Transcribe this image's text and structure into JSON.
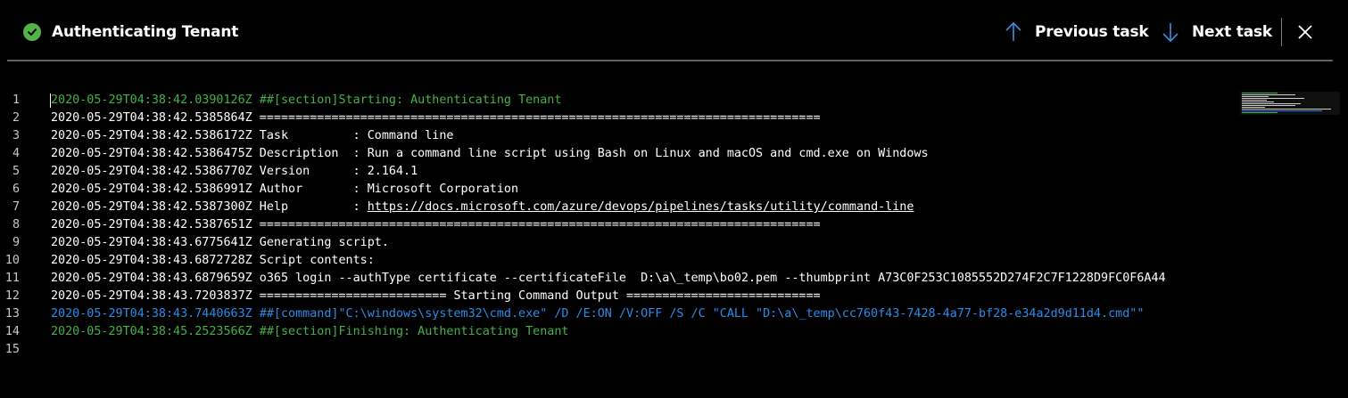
{
  "header": {
    "title": "Authenticating Tenant",
    "status_icon": "success-check-icon",
    "previous_label": "Previous task",
    "next_label": "Next task",
    "close_icon": "close-icon"
  },
  "colors": {
    "background": "#000000",
    "success": "#55b24a",
    "section_text": "#46b04a",
    "command_text": "#2d8be8",
    "nav_arrow": "#3a8ee6"
  },
  "log": {
    "lines": [
      {
        "num": "1",
        "text": "2020-05-29T04:38:42.0390126Z ##[section]Starting: Authenticating Tenant"
      },
      {
        "num": "2",
        "text": "2020-05-29T04:38:42.5385864Z =============================================================================="
      },
      {
        "num": "3",
        "text": "2020-05-29T04:38:42.5386172Z Task         : Command line"
      },
      {
        "num": "4",
        "text": "2020-05-29T04:38:42.5386475Z Description  : Run a command line script using Bash on Linux and macOS and cmd.exe on Windows"
      },
      {
        "num": "5",
        "text": "2020-05-29T04:38:42.5386770Z Version      : 2.164.1"
      },
      {
        "num": "6",
        "text": "2020-05-29T04:38:42.5386991Z Author       : Microsoft Corporation"
      },
      {
        "num": "7",
        "prefix": "2020-05-29T04:38:42.5387300Z Help         : ",
        "link": "https://docs.microsoft.com/azure/devops/pipelines/tasks/utility/command-line"
      },
      {
        "num": "8",
        "text": "2020-05-29T04:38:42.5387651Z =============================================================================="
      },
      {
        "num": "9",
        "text": "2020-05-29T04:38:43.6775641Z Generating script."
      },
      {
        "num": "10",
        "text": "2020-05-29T04:38:43.6872728Z Script contents:"
      },
      {
        "num": "11",
        "text": "2020-05-29T04:38:43.6879659Z o365 login --authType certificate --certificateFile  D:\\a\\_temp\\bo02.pem --thumbprint A73C0F253C1085552D274F2C7F1228D9FC0F6A44"
      },
      {
        "num": "12",
        "text": "2020-05-29T04:38:43.7203837Z ========================== Starting Command Output ==========================="
      },
      {
        "num": "13",
        "text": "2020-05-29T04:38:43.7440663Z ##[command]\"C:\\windows\\system32\\cmd.exe\" /D /E:ON /V:OFF /S /C \"CALL \"D:\\a\\_temp\\cc760f43-7428-4a77-bf28-e34a2d9d11d4.cmd\"\""
      },
      {
        "num": "14",
        "text": "2020-05-29T04:38:45.2523566Z ##[section]Finishing: Authenticating Tenant"
      },
      {
        "num": "15",
        "text": ""
      }
    ]
  }
}
